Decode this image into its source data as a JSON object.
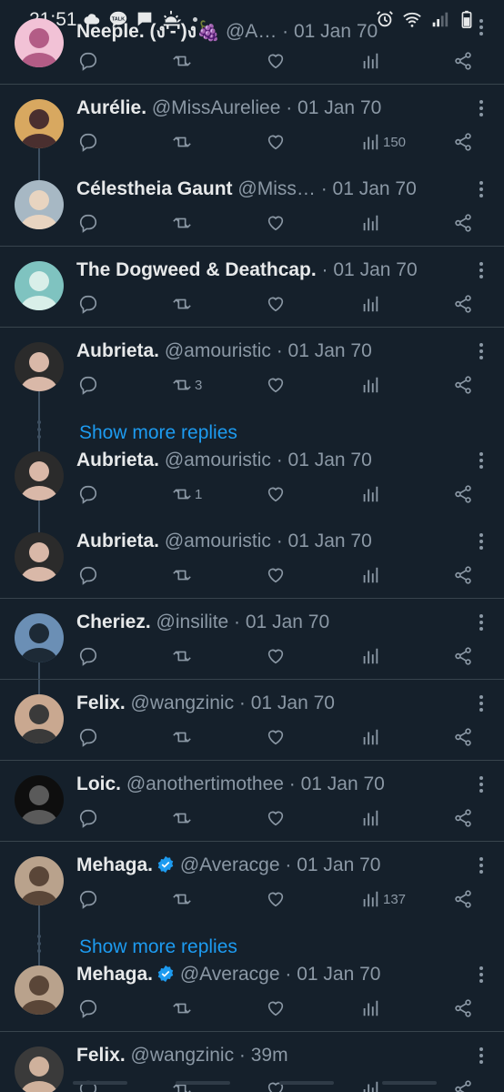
{
  "status_bar": {
    "time": "21:51",
    "left_icons": [
      "cloud-icon",
      "talk-icon",
      "sunrise-icon"
    ],
    "right_icons": [
      "alarm-icon",
      "wifi-icon",
      "signal-icon",
      "battery-icon"
    ]
  },
  "tweets": [
    {
      "name": "Neeple. (ง'̀-'́)ง🍇",
      "handle": "@A…",
      "time": "· 01 Jan 70",
      "retweets": "",
      "views": "",
      "verified": false
    },
    {
      "name": "Aurélie.",
      "handle": "@MissAureliee",
      "time": "· 01 Jan 70",
      "retweets": "",
      "views": "150",
      "verified": false
    },
    {
      "name": "Célestheia Gaunt",
      "handle": "@Miss…",
      "time": "· 01 Jan 70",
      "retweets": "",
      "views": "",
      "verified": false
    },
    {
      "name": "The Dogweed & Deathcap.",
      "handle": "",
      "time": "· 01 Jan 70",
      "retweets": "",
      "views": "",
      "verified": false
    },
    {
      "name": "Aubrieta.",
      "handle": "@amouristic",
      "time": "· 01 Jan 70",
      "retweets": "3",
      "views": "",
      "verified": false
    },
    {
      "name": "Aubrieta.",
      "handle": "@amouristic",
      "time": "· 01 Jan 70",
      "retweets": "1",
      "views": "",
      "verified": false
    },
    {
      "name": "Aubrieta.",
      "handle": "@amouristic",
      "time": "· 01 Jan 70",
      "retweets": "",
      "views": "",
      "verified": false
    },
    {
      "name": "Cheriez.",
      "handle": "@insilite",
      "time": "· 01 Jan 70",
      "retweets": "",
      "views": "",
      "verified": false
    },
    {
      "name": "Felix.",
      "handle": "@wangzinic",
      "time": "· 01 Jan 70",
      "retweets": "",
      "views": "",
      "verified": false
    },
    {
      "name": "Loic.",
      "handle": "@anothertimothee",
      "time": "· 01 Jan 70",
      "retweets": "",
      "views": "",
      "verified": false
    },
    {
      "name": "Mehaga.",
      "handle": "@Averacge",
      "time": "· 01 Jan 70",
      "retweets": "",
      "views": "137",
      "verified": true
    },
    {
      "name": "Mehaga.",
      "handle": "@Averacge",
      "time": "· 01 Jan 70",
      "retweets": "",
      "views": "",
      "verified": true
    },
    {
      "name": "Felix.",
      "handle": "@wangzinic",
      "time": "· 39m",
      "retweets": "",
      "views": "",
      "verified": false
    }
  ],
  "show_more": [
    "Show more replies",
    "Show more replies"
  ],
  "colors": {
    "background": "#15202b",
    "accent": "#1d9bf0",
    "muted": "#8b98a5",
    "divider": "#38444d"
  }
}
